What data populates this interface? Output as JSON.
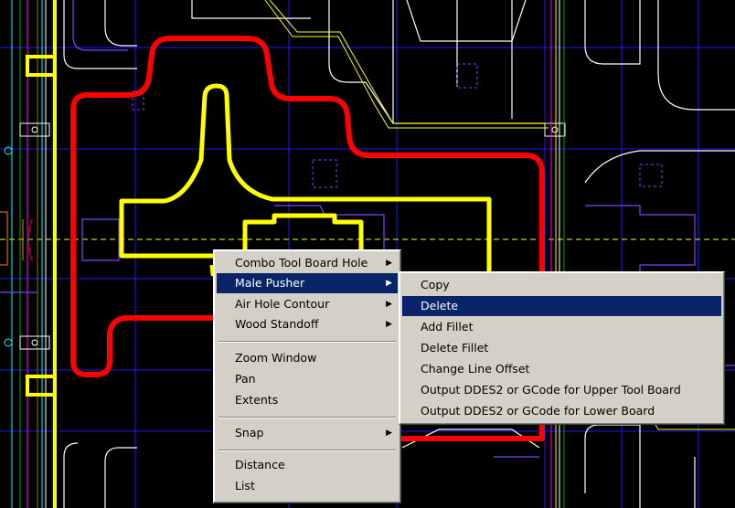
{
  "context_menu": {
    "items": [
      {
        "label": "Combo Tool Board Hole",
        "submenu": true
      },
      {
        "label": "Male Pusher",
        "submenu": true,
        "selected": true
      },
      {
        "label": "Air Hole Contour",
        "submenu": true
      },
      {
        "label": "Wood Standoff",
        "submenu": true
      },
      {
        "label": "Zoom Window"
      },
      {
        "label": "Pan"
      },
      {
        "label": "Extents"
      },
      {
        "label": "Snap",
        "submenu": true
      },
      {
        "label": "Distance"
      },
      {
        "label": "List"
      }
    ]
  },
  "submenu": {
    "items": [
      {
        "label": "Copy"
      },
      {
        "label": "Delete",
        "selected": true
      },
      {
        "label": "Add Fillet"
      },
      {
        "label": "Delete Fillet"
      },
      {
        "label": "Change Line Offset"
      },
      {
        "label": "Output DDES2 or GCode for Upper Tool Board"
      },
      {
        "label": "Output DDES2 or GCode for Lower Board"
      }
    ]
  },
  "colors": {
    "background": "#000000",
    "grid": "#0000ff",
    "contour_red": "#ff0000",
    "contour_yellow": "#ffff00",
    "outline_white": "#ffffff",
    "outline_purple": "#8040ff",
    "centerline": "#ffff00",
    "menu_bg": "#d4d0c8",
    "menu_highlight": "#0a246a"
  },
  "arrow_glyph": "▶"
}
